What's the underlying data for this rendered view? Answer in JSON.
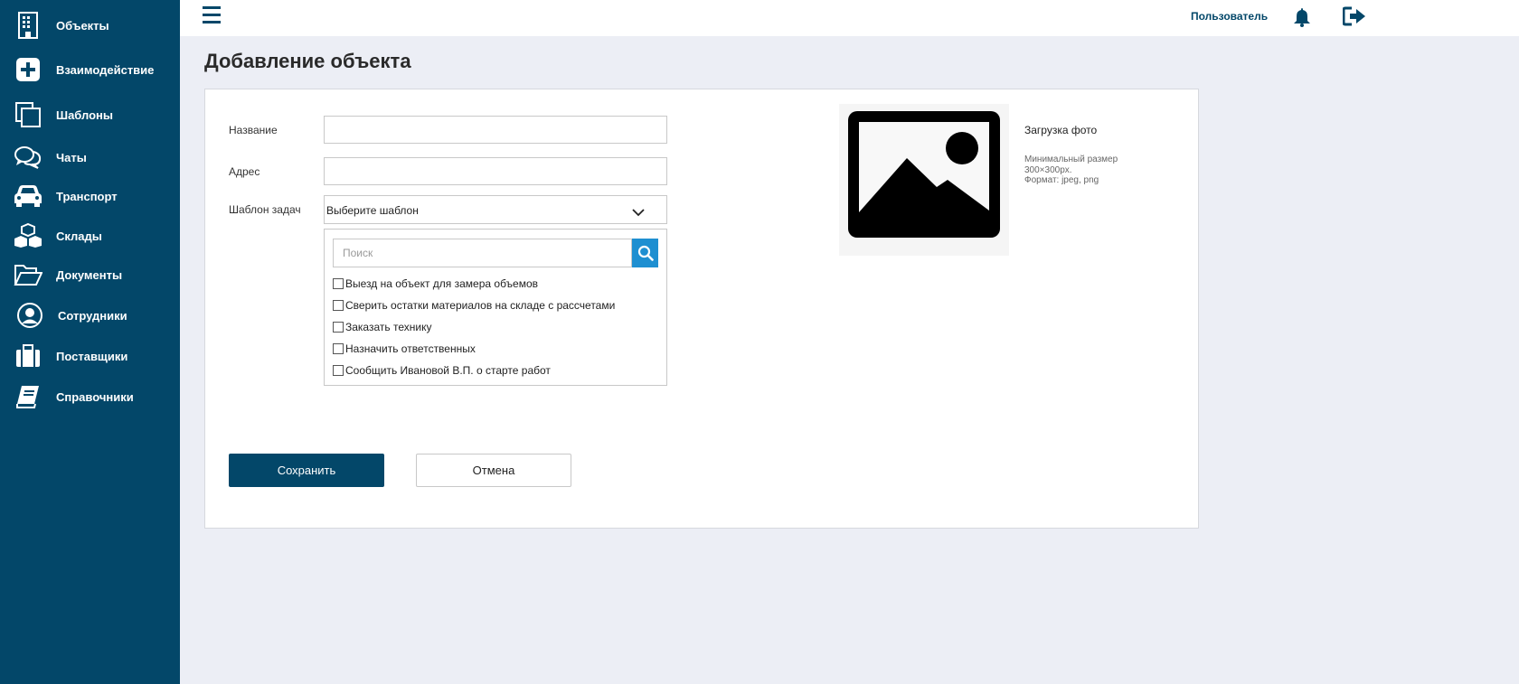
{
  "sidebar": {
    "items": [
      {
        "label": "Объекты",
        "icon": "building-icon"
      },
      {
        "label": "Взаимодействие",
        "icon": "plus-square-icon"
      },
      {
        "label": "Шаблоны",
        "icon": "copy-icon"
      },
      {
        "label": "Чаты",
        "icon": "chat-icon"
      },
      {
        "label": "Транспорт",
        "icon": "car-icon"
      },
      {
        "label": "Склады",
        "icon": "boxes-icon"
      },
      {
        "label": "Документы",
        "icon": "folder-open-icon"
      },
      {
        "label": "Сотрудники",
        "icon": "user-circle-icon"
      },
      {
        "label": "Поставщики",
        "icon": "briefcase-icon"
      },
      {
        "label": "Справочники",
        "icon": "book-icon"
      }
    ]
  },
  "header": {
    "user_label": "Пользователь",
    "menu_icon": "hamburger-icon",
    "bell_icon": "bell-icon",
    "logout_icon": "logout-icon"
  },
  "page": {
    "title": "Добавление объекта"
  },
  "form": {
    "name_label": "Название",
    "name_value": "",
    "address_label": "Адрес",
    "address_value": "",
    "template_label": "Шаблон задач",
    "template_selected": "Выберите шаблон",
    "search_placeholder": "Поиск",
    "options": [
      {
        "label": "Выезд на объект для замера объемов",
        "checked": false
      },
      {
        "label": "Сверить остатки материалов на складе с рассчетами",
        "checked": false
      },
      {
        "label": "Заказать технику",
        "checked": false
      },
      {
        "label": "Назначить ответственных",
        "checked": false
      },
      {
        "label": "Сообщить Ивановой В.П. о старте работ",
        "checked": false
      }
    ],
    "save_label": "Сохранить",
    "cancel_label": "Отмена"
  },
  "photo": {
    "title": "Загрузка фото",
    "hint_lines": [
      "Минимальный размер",
      "300×300px.",
      "Формат: jpeg, png"
    ]
  },
  "colors": {
    "sidebar": "#034769",
    "accent": "#1e8fd1",
    "background": "#eceef5"
  }
}
